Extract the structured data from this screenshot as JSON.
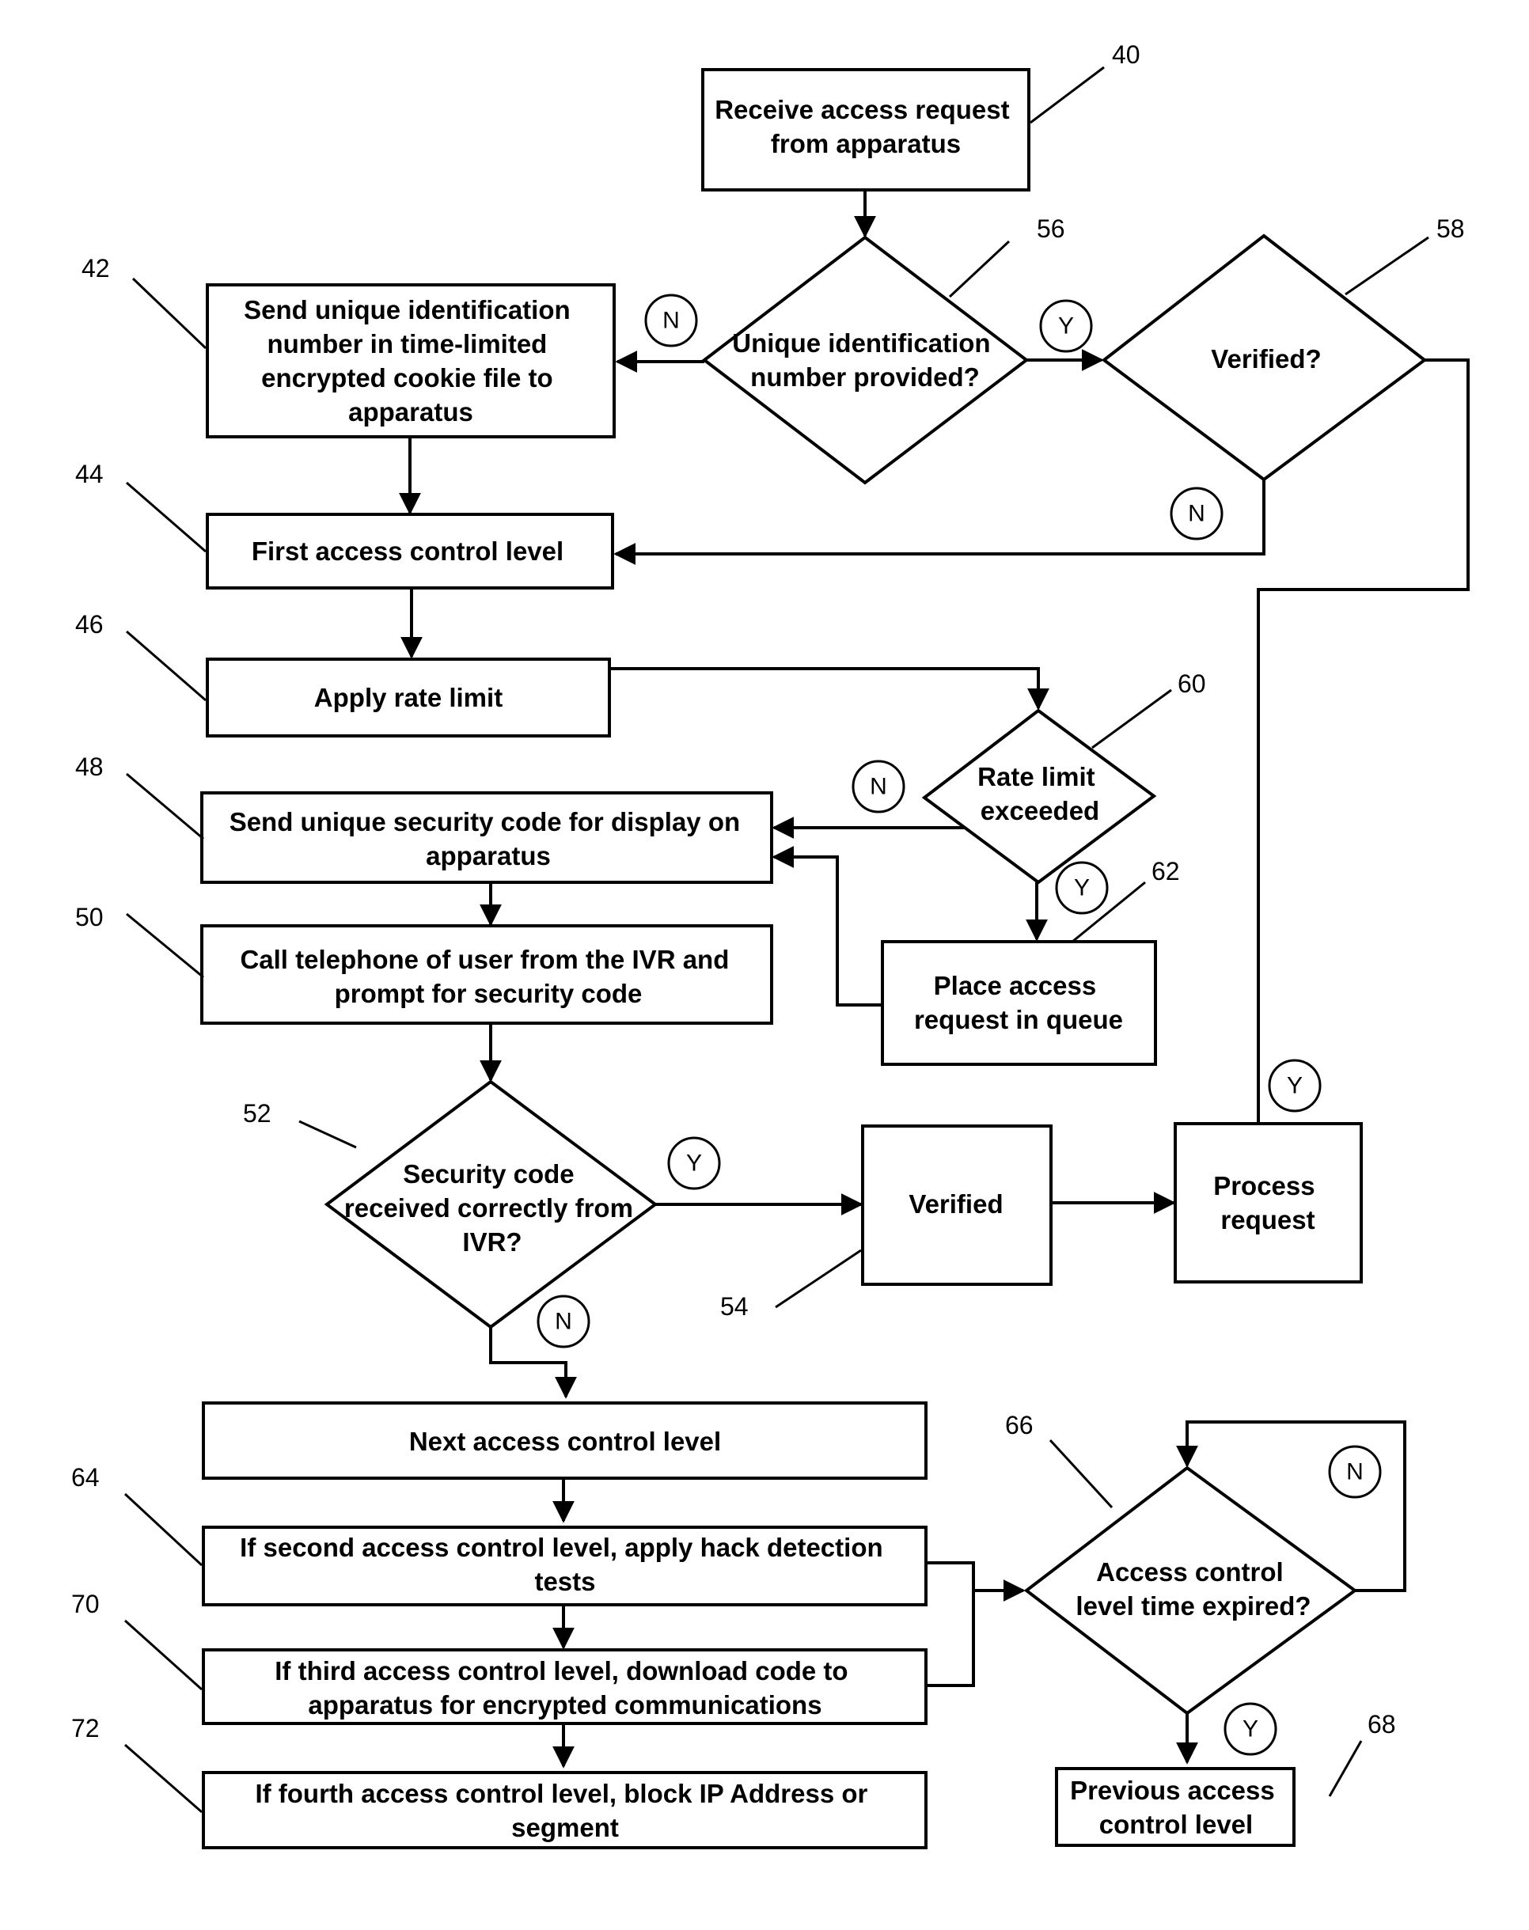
{
  "nodes": {
    "n40": {
      "ref": "40",
      "lines": [
        "Receive access request",
        "from apparatus"
      ]
    },
    "n56": {
      "ref": "56",
      "lines": [
        "Unique identification",
        "number provided?"
      ]
    },
    "n58": {
      "ref": "58",
      "lines": [
        "Verified?"
      ]
    },
    "n42": {
      "ref": "42",
      "lines": [
        "Send unique identification",
        "number in time-limited",
        "encrypted cookie file to",
        "apparatus"
      ]
    },
    "n44": {
      "ref": "44",
      "lines": [
        "First access control level"
      ]
    },
    "n46": {
      "ref": "46",
      "lines": [
        "Apply rate limit"
      ]
    },
    "n60": {
      "ref": "60",
      "lines": [
        "Rate limit",
        "exceeded"
      ]
    },
    "n48": {
      "ref": "48",
      "lines": [
        "Send unique security code for display on",
        "apparatus"
      ]
    },
    "n62": {
      "ref": "62",
      "lines": [
        "Place access",
        "request in queue"
      ]
    },
    "n50": {
      "ref": "50",
      "lines": [
        "Call telephone of user from the IVR and",
        "prompt for security code"
      ]
    },
    "n52": {
      "ref": "52",
      "lines": [
        "Security code",
        "received correctly from",
        "IVR?"
      ]
    },
    "n54": {
      "ref": "54",
      "lines": [
        "Verified"
      ]
    },
    "process": {
      "lines": [
        "Process",
        "request"
      ]
    },
    "next": {
      "lines": [
        "Next access control level"
      ]
    },
    "n64": {
      "ref": "64",
      "lines": [
        "If second access control level, apply hack detection",
        "tests"
      ]
    },
    "n70": {
      "ref": "70",
      "lines": [
        "If third access control level, download code to",
        "apparatus for encrypted communications"
      ]
    },
    "n72": {
      "ref": "72",
      "lines": [
        "If fourth access control level, block IP Address or",
        "segment"
      ]
    },
    "n66": {
      "ref": "66",
      "lines": [
        "Access control",
        "level time expired?"
      ]
    },
    "n68": {
      "ref": "68",
      "lines": [
        "Previous access",
        "control level"
      ]
    }
  },
  "badges": {
    "yes": "Y",
    "no": "N"
  }
}
